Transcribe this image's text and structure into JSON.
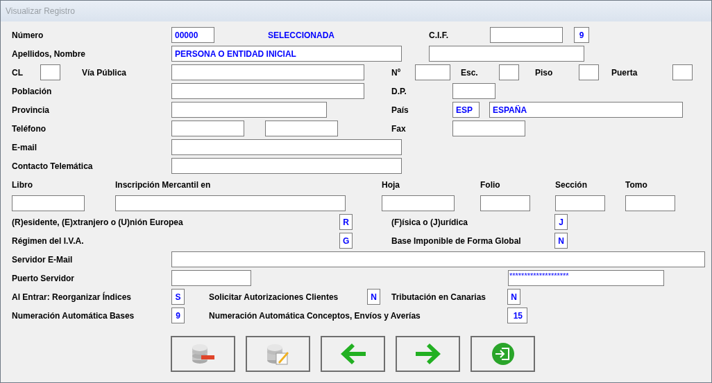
{
  "window": {
    "title": "Visualizar Registro"
  },
  "rows": [
    {
      "items": [
        {
          "kind": "label",
          "text": "Número"
        },
        {
          "kind": "field",
          "value": "00000"
        },
        {
          "kind": "status",
          "text": "SELECCIONADA"
        },
        {
          "kind": "label",
          "text": "C.I.F."
        },
        {
          "kind": "field"
        },
        {
          "kind": "field",
          "value": "9"
        }
      ]
    },
    {
      "items": [
        {
          "kind": "label",
          "text": "Apellidos, Nombre"
        },
        {
          "kind": "field",
          "value": "PERSONA O ENTIDAD INICIAL"
        },
        {
          "kind": "field"
        }
      ]
    },
    {
      "items": [
        {
          "kind": "label",
          "text": "CL"
        },
        {
          "kind": "field"
        },
        {
          "kind": "label",
          "text": "Vía Pública"
        },
        {
          "kind": "field"
        },
        {
          "kind": "label",
          "text": "Nº"
        },
        {
          "kind": "field"
        },
        {
          "kind": "label",
          "text": "Esc."
        },
        {
          "kind": "field"
        },
        {
          "kind": "label",
          "text": "Piso"
        },
        {
          "kind": "field"
        },
        {
          "kind": "label",
          "text": "Puerta"
        },
        {
          "kind": "field"
        }
      ]
    },
    {
      "items": [
        {
          "kind": "label",
          "text": "Población"
        },
        {
          "kind": "field"
        },
        {
          "kind": "label",
          "text": "D.P."
        },
        {
          "kind": "field"
        }
      ]
    },
    {
      "items": [
        {
          "kind": "label",
          "text": "Provincia"
        },
        {
          "kind": "field"
        },
        {
          "kind": "label",
          "text": "País"
        },
        {
          "kind": "field",
          "value": "ESP"
        },
        {
          "kind": "field",
          "value": "ESPAÑA"
        }
      ]
    },
    {
      "items": [
        {
          "kind": "label",
          "text": "Teléfono"
        },
        {
          "kind": "field"
        },
        {
          "kind": "field"
        },
        {
          "kind": "label",
          "text": "Fax"
        },
        {
          "kind": "field"
        }
      ]
    },
    {
      "items": [
        {
          "kind": "label",
          "text": "E-mail"
        },
        {
          "kind": "field"
        }
      ]
    },
    {
      "items": [
        {
          "kind": "label",
          "text": "Contacto Telemática"
        },
        {
          "kind": "field"
        }
      ]
    },
    {
      "items": [
        {
          "kind": "label",
          "text": "Libro"
        },
        {
          "kind": "label",
          "text": "Inscripción Mercantil en"
        },
        {
          "kind": "label",
          "text": "Hoja"
        },
        {
          "kind": "label",
          "text": "Folio"
        },
        {
          "kind": "label",
          "text": "Sección"
        },
        {
          "kind": "label",
          "text": "Tomo"
        }
      ]
    },
    {
      "items": [
        {
          "kind": "field"
        },
        {
          "kind": "field"
        },
        {
          "kind": "field"
        },
        {
          "kind": "field"
        },
        {
          "kind": "field"
        },
        {
          "kind": "field"
        }
      ]
    },
    {
      "items": [
        {
          "kind": "label",
          "text": "(R)esidente, (E)xtranjero o (U)nión Europea"
        },
        {
          "kind": "field",
          "value": "R"
        },
        {
          "kind": "label",
          "text": "(F)ísica o (J)urídica"
        },
        {
          "kind": "field",
          "value": "J"
        }
      ]
    },
    {
      "items": [
        {
          "kind": "label",
          "text": "Régimen del I.V.A."
        },
        {
          "kind": "field",
          "value": "G"
        },
        {
          "kind": "label",
          "text": "Base Imponible de Forma Global"
        },
        {
          "kind": "field",
          "value": "N"
        }
      ]
    },
    {
      "items": [
        {
          "kind": "label",
          "text": "Servidor E-Mail"
        },
        {
          "kind": "field"
        }
      ]
    },
    {
      "items": [
        {
          "kind": "label",
          "text": "Puerto Servidor"
        },
        {
          "kind": "field"
        },
        {
          "kind": "password",
          "value": "********************"
        }
      ]
    },
    {
      "items": [
        {
          "kind": "label",
          "text": "Al Entrar: Reorganizar Índices"
        },
        {
          "kind": "field",
          "value": "S"
        },
        {
          "kind": "label",
          "text": "Solicitar Autorizaciones Clientes"
        },
        {
          "kind": "field",
          "value": "N"
        },
        {
          "kind": "label",
          "text": "Tributación en Canarias"
        },
        {
          "kind": "field",
          "value": "N"
        }
      ]
    },
    {
      "items": [
        {
          "kind": "label",
          "text": "Numeración Automática Bases"
        },
        {
          "kind": "field",
          "value": "9"
        },
        {
          "kind": "label",
          "text": "Numeración Automática Conceptos, Envíos y Averías"
        },
        {
          "kind": "field",
          "value": "15"
        }
      ]
    }
  ]
}
